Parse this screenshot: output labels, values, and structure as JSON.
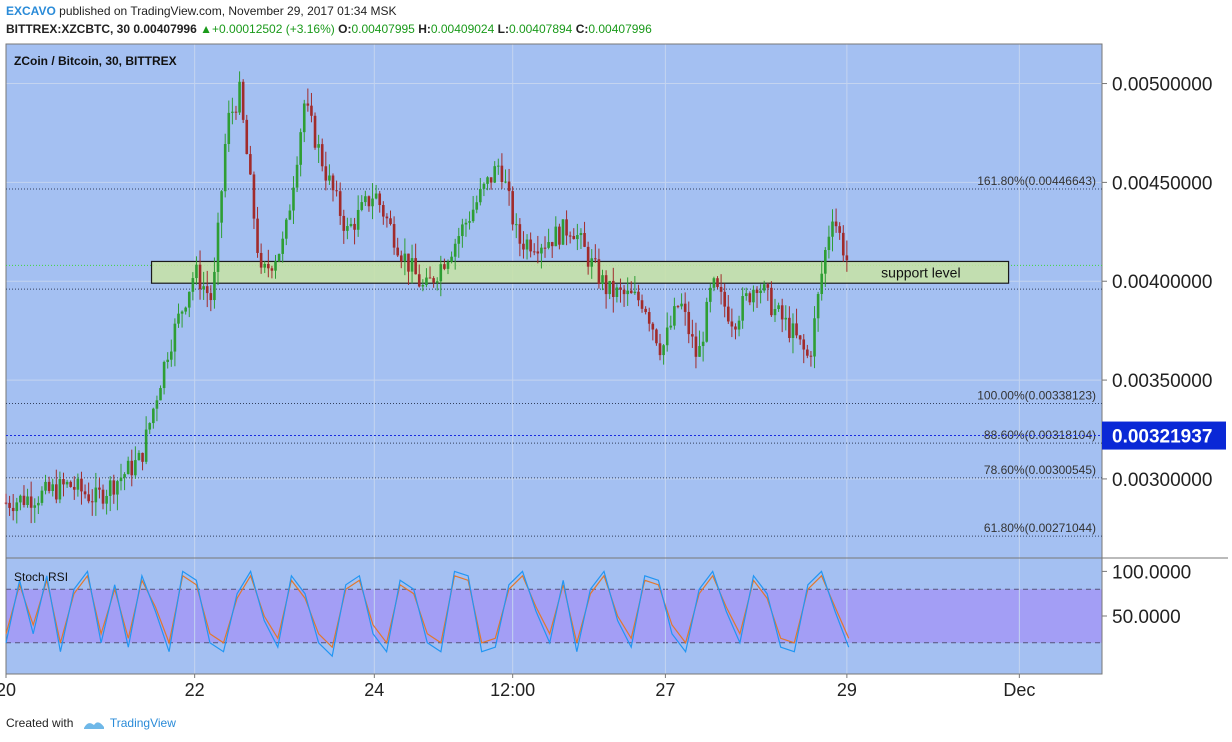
{
  "header": {
    "username": "EXCAVO",
    "published_text": "published on TradingView.com, November 29, 2017 01:34 MSK",
    "symbol_line": "BITTREX:XZCBTC, 30",
    "last": "0.00407996",
    "change_arrow": "▲",
    "change": "+0.00012502 (+3.16%)",
    "o_label": "O:",
    "o_value": "0.00407995",
    "h_label": "H:",
    "h_value": "0.00409024",
    "l_label": "L:",
    "l_value": "0.00407894",
    "c_label": "C:",
    "c_value": "0.00407996"
  },
  "footer": {
    "created_with": "Created with",
    "brand": "TradingView"
  },
  "colors": {
    "background": "#a4c0f2",
    "up_candle": "#2e9e34",
    "down_candle": "#a12b2b",
    "support_fill": "#c8e3a4",
    "rsi_band": "#a39ef5",
    "k_line": "#e2782c",
    "d_line": "#2196f3",
    "price_badge": "#0a28d6"
  },
  "chart_data": [
    {
      "type": "candlestick",
      "title": "ZCoin / Bitcoin, 30, BITTREX",
      "ylim": [
        0.0026,
        0.0052
      ],
      "yticks": [
        "0.00500000",
        "0.00450000",
        "0.00400000",
        "0.00350000",
        "0.00300000"
      ],
      "ytick_values": [
        0.005,
        0.0045,
        0.004,
        0.0035,
        0.003
      ],
      "xticks": [
        "20",
        "22",
        "24",
        "12:00",
        "27",
        "29",
        "Dec"
      ],
      "xtick_values": [
        0,
        10.5,
        20.5,
        28.2,
        36.7,
        46.8,
        56.4
      ],
      "xlim": [
        0,
        61
      ],
      "last_price": "0.00321937",
      "last_price_value": 0.00321937,
      "green_line_value": 0.00408,
      "fib_levels": [
        {
          "label": "161.80%(0.00446643)",
          "value": 0.00446643
        },
        {
          "label": "100.00%(0.00338123)",
          "value": 0.00338123
        },
        {
          "label": "88.60%(0.00318104)",
          "value": 0.00318104
        },
        {
          "label": "78.60%(0.00300545)",
          "value": 0.00300545
        },
        {
          "label": "61.80%(0.00271044)",
          "value": 0.00271044
        }
      ],
      "extra_line_value": 0.00396,
      "support_zone": {
        "label": "support level",
        "x_from": 8.1,
        "x_to": 55.8,
        "low": 0.00399,
        "high": 0.0041
      },
      "price_path": [
        [
          0,
          0.00288
        ],
        [
          2,
          0.00292
        ],
        [
          3.5,
          0.00297
        ],
        [
          5,
          0.0029
        ],
        [
          6.5,
          0.00302
        ],
        [
          7.5,
          0.0031
        ],
        [
          9,
          0.00365
        ],
        [
          10.5,
          0.00405
        ],
        [
          11.5,
          0.0039
        ],
        [
          12.3,
          0.0048
        ],
        [
          13,
          0.00495
        ],
        [
          14.2,
          0.00402
        ],
        [
          15.5,
          0.0042
        ],
        [
          16.6,
          0.0049
        ],
        [
          17.8,
          0.00455
        ],
        [
          19,
          0.00425
        ],
        [
          20.5,
          0.00445
        ],
        [
          22,
          0.00415
        ],
        [
          23.3,
          0.00395
        ],
        [
          25,
          0.0042
        ],
        [
          26.5,
          0.00445
        ],
        [
          27.5,
          0.0046
        ],
        [
          28.5,
          0.0042
        ],
        [
          30,
          0.0042
        ],
        [
          31.5,
          0.00428
        ],
        [
          32.5,
          0.0041
        ],
        [
          33.5,
          0.00395
        ],
        [
          35.5,
          0.0039
        ],
        [
          36.5,
          0.00365
        ],
        [
          37.5,
          0.0039
        ],
        [
          38.5,
          0.0036
        ],
        [
          39.3,
          0.00398
        ],
        [
          40.5,
          0.0038
        ],
        [
          41.8,
          0.004
        ],
        [
          42.8,
          0.00385
        ],
        [
          43.7,
          0.00375
        ],
        [
          44.7,
          0.0036
        ],
        [
          45.5,
          0.0041
        ],
        [
          46,
          0.00435
        ],
        [
          46.5,
          0.0042
        ],
        [
          46.9,
          0.00408
        ]
      ]
    },
    {
      "type": "line",
      "title": "Stoch RSI",
      "ylim": [
        -15,
        115
      ],
      "yticks": [
        "100.0000",
        "50.0000"
      ],
      "ytick_values": [
        100,
        50
      ],
      "band": [
        20,
        80
      ],
      "series": [
        {
          "values": [
            30,
            85,
            40,
            90,
            20,
            75,
            95,
            30,
            80,
            25,
            90,
            60,
            20,
            95,
            85,
            30,
            20,
            70,
            95,
            50,
            25,
            90,
            70,
            30,
            15,
            80,
            90,
            40,
            20,
            85,
            75,
            30,
            20,
            95,
            90,
            20,
            25,
            80,
            95,
            60,
            30,
            85,
            20,
            75,
            95,
            50,
            25,
            90,
            85,
            40,
            20,
            75,
            95,
            60,
            30,
            90,
            70,
            25,
            20,
            80,
            95,
            60,
            25
          ]
        },
        {
          "values": [
            20,
            90,
            30,
            95,
            10,
            80,
            100,
            20,
            85,
            15,
            95,
            55,
            10,
            100,
            90,
            20,
            10,
            75,
            100,
            45,
            15,
            95,
            75,
            20,
            5,
            85,
            95,
            30,
            10,
            90,
            80,
            20,
            10,
            100,
            95,
            10,
            15,
            85,
            100,
            55,
            20,
            90,
            10,
            80,
            100,
            45,
            15,
            95,
            90,
            30,
            10,
            80,
            100,
            55,
            20,
            95,
            75,
            15,
            10,
            85,
            100,
            55,
            15
          ]
        }
      ]
    }
  ]
}
